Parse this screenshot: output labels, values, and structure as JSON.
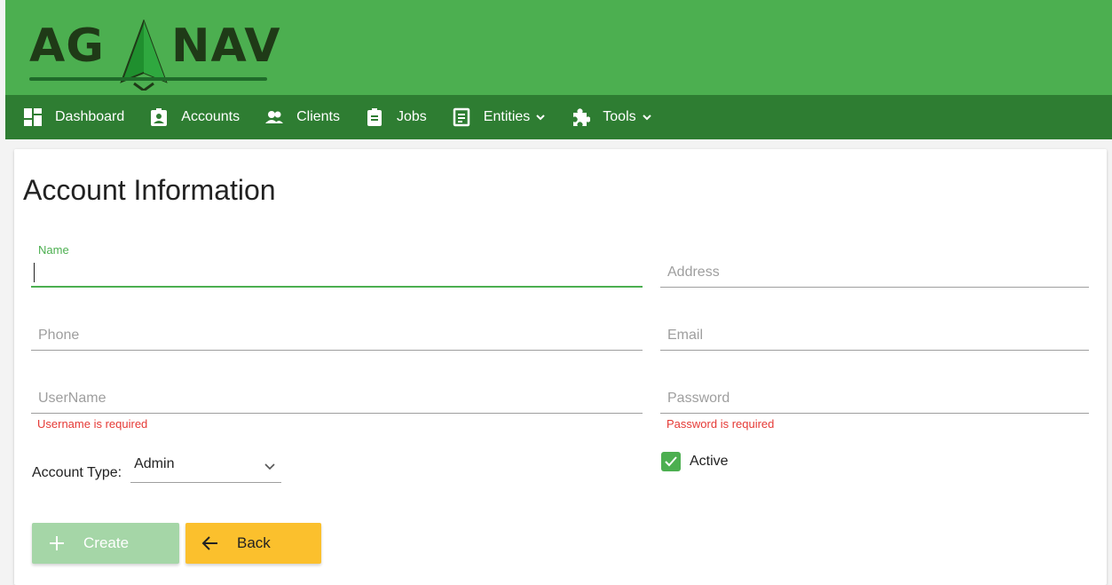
{
  "brand": {
    "logo_text_left": "AG",
    "logo_text_right": "NAV"
  },
  "colors": {
    "header": "#4caf50",
    "nav": "#2e7d32",
    "accent": "#4caf50",
    "error": "#e53935",
    "back_button": "#fbc02d"
  },
  "nav": {
    "items": [
      {
        "label": "Dashboard",
        "icon": "dashboard-icon"
      },
      {
        "label": "Accounts",
        "icon": "account-box-icon"
      },
      {
        "label": "Clients",
        "icon": "people-icon"
      },
      {
        "label": "Jobs",
        "icon": "clipboard-icon"
      },
      {
        "label": "Entities",
        "icon": "list-icon",
        "dropdown": true
      },
      {
        "label": "Tools",
        "icon": "puzzle-icon",
        "dropdown": true
      }
    ]
  },
  "form": {
    "title": "Account Information",
    "name": {
      "label": "Name",
      "value": ""
    },
    "address": {
      "label": "Address",
      "value": ""
    },
    "phone": {
      "label": "Phone",
      "value": ""
    },
    "email": {
      "label": "Email",
      "value": ""
    },
    "username": {
      "label": "UserName",
      "value": "",
      "error": "Username is required"
    },
    "password": {
      "label": "Password",
      "value": "",
      "error": "Password is required"
    },
    "account_type": {
      "label": "Account Type:",
      "value": "Admin"
    },
    "active": {
      "label": "Active",
      "checked": true
    }
  },
  "buttons": {
    "create": "Create",
    "back": "Back"
  }
}
